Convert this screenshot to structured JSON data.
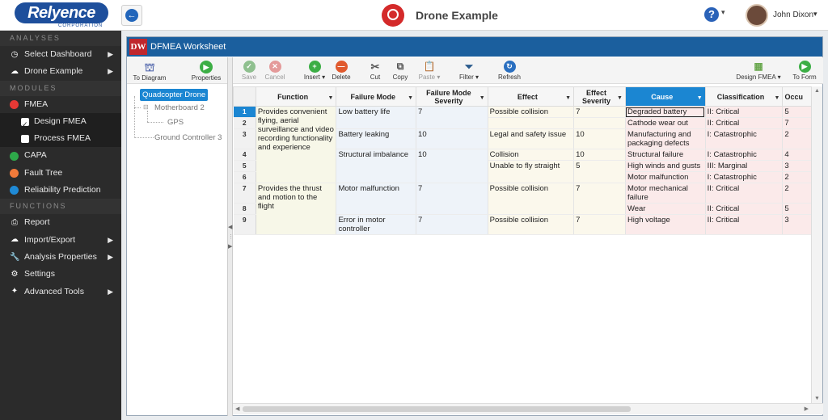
{
  "header": {
    "logo_text": "Relyence",
    "logo_sub": "CORPORATION",
    "app_title": "Drone Example",
    "user_name": "John Dixon"
  },
  "sidebar": {
    "analyses_label": "ANALYSES",
    "analyses": [
      {
        "label": "Select Dashboard",
        "icon": "dashboard-icon"
      },
      {
        "label": "Drone Example",
        "icon": "cloud-icon"
      }
    ],
    "modules_label": "MODULES",
    "modules": {
      "fmea": {
        "label": "FMEA",
        "color": "#e53935"
      },
      "design_fmea": "Design FMEA",
      "process_fmea": "Process FMEA",
      "capa": {
        "label": "CAPA",
        "color": "#2ea84a"
      },
      "fault_tree": {
        "label": "Fault Tree",
        "color": "#f07a3a"
      },
      "reliability": {
        "label": "Reliability Prediction",
        "color": "#1f8ad6"
      }
    },
    "functions_label": "FUNCTIONS",
    "functions": [
      {
        "label": "Report",
        "icon": "printer-icon"
      },
      {
        "label": "Import/Export",
        "icon": "cloud-upload-icon"
      },
      {
        "label": "Analysis Properties",
        "icon": "wrench-icon"
      },
      {
        "label": "Settings",
        "icon": "gear-icon"
      },
      {
        "label": "Advanced Tools",
        "icon": "magic-wand-icon"
      }
    ]
  },
  "panel": {
    "badge": "DW",
    "title": "DFMEA Worksheet"
  },
  "tree_toolbar": {
    "to_diagram": "To Diagram",
    "properties": "Properties"
  },
  "tree": {
    "root": "Quadcopter Drone",
    "child1": "Motherboard 2",
    "grandchild1": "GPS",
    "child2": "Ground Controller 3"
  },
  "grid_toolbar": {
    "save": "Save",
    "cancel": "Cancel",
    "insert": "Insert",
    "delete": "Delete",
    "cut": "Cut",
    "copy": "Copy",
    "paste": "Paste",
    "filter": "Filter",
    "refresh": "Refresh",
    "design_fmea": "Design FMEA",
    "to_form": "To Form"
  },
  "grid": {
    "columns": {
      "function": "Function",
      "failure_mode": "Failure Mode",
      "failure_mode_severity": "Failure Mode Severity",
      "effect": "Effect",
      "effect_severity": "Effect Severity",
      "cause": "Cause",
      "classification": "Classification",
      "occurrence": "Occu"
    },
    "rows": [
      {
        "n": "1",
        "function": "Provides convenient flying, aerial surveillance and video recording functionality and experience",
        "fm": "Low battery life",
        "fms": "7",
        "eff": "Possible collision",
        "effs": "7",
        "cause": "Degraded battery",
        "cls": "II: Critical",
        "occ": "5"
      },
      {
        "n": "2",
        "function": "",
        "fm": "",
        "fms": "",
        "eff": "",
        "effs": "",
        "cause": "Cathode wear out",
        "cls": "II: Critical",
        "occ": "7"
      },
      {
        "n": "3",
        "function": "",
        "fm": "Battery leaking",
        "fms": "10",
        "eff": "Legal and safety issue",
        "effs": "10",
        "cause": "Manufacturing and packaging defects",
        "cls": "I: Catastrophic",
        "occ": "2"
      },
      {
        "n": "4",
        "function": "",
        "fm": "Structural imbalance",
        "fms": "10",
        "eff": "Collision",
        "effs": "10",
        "cause": "Structural failure",
        "cls": "I: Catastrophic",
        "occ": "4"
      },
      {
        "n": "5",
        "function": "",
        "fm": "",
        "fms": "",
        "eff": "Unable to fly straight",
        "effs": "5",
        "cause": "High winds and gusts",
        "cls": "III: Marginal",
        "occ": "3"
      },
      {
        "n": "6",
        "function": "",
        "fm": "",
        "fms": "",
        "eff": "",
        "effs": "",
        "cause": "Motor malfunction",
        "cls": "I: Catastrophic",
        "occ": "2"
      },
      {
        "n": "7",
        "function": "Provides the thrust and motion to the flight",
        "fm": "Motor malfunction",
        "fms": "7",
        "eff": "Possible collision",
        "effs": "7",
        "cause": "Motor mechanical failure",
        "cls": "II: Critical",
        "occ": "2"
      },
      {
        "n": "8",
        "function": "",
        "fm": "",
        "fms": "",
        "eff": "",
        "effs": "",
        "cause": "Wear",
        "cls": "II: Critical",
        "occ": "5"
      },
      {
        "n": "9",
        "function": "",
        "fm": "Error in motor controller",
        "fms": "7",
        "eff": "Possible collision",
        "effs": "7",
        "cause": "High voltage",
        "cls": "II: Critical",
        "occ": "3"
      }
    ]
  }
}
